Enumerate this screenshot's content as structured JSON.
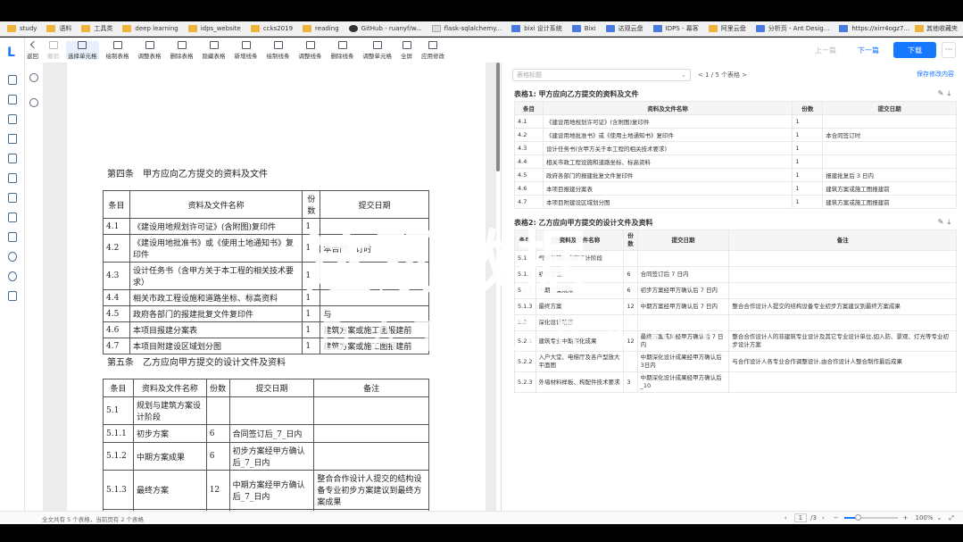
{
  "bookmarks": [
    {
      "label": "study",
      "icon": "folder-icon"
    },
    {
      "label": "语料",
      "icon": "folder-icon"
    },
    {
      "label": "工具类",
      "icon": "folder-icon"
    },
    {
      "label": "deep learning",
      "icon": "folder-icon"
    },
    {
      "label": "idps_website",
      "icon": "folder-icon"
    },
    {
      "label": "ccks2019",
      "icon": "folder-icon"
    },
    {
      "label": "reading",
      "icon": "folder-icon"
    },
    {
      "label": "GitHub - ruanyf/w...",
      "icon": "github-icon"
    },
    {
      "label": "flask-sqlalchemy...",
      "icon": "page-icon"
    },
    {
      "label": "bixi 设计系统",
      "icon": "site-icon"
    },
    {
      "label": "Bixi",
      "icon": "site-icon"
    },
    {
      "label": "达观云盘",
      "icon": "site-icon"
    },
    {
      "label": "IDPS - 幕客",
      "icon": "site-icon"
    },
    {
      "label": "阿里云盘",
      "icon": "folder-icon"
    },
    {
      "label": "分析页 - Ant Desig...",
      "icon": "site-icon"
    },
    {
      "label": "https://xirr4ogz7...",
      "icon": "site-icon"
    }
  ],
  "bookmarks_other": "其他收藏夹",
  "toolbar": [
    {
      "label": "返回",
      "icon": "back-icon",
      "state": "normal"
    },
    {
      "label": "撤销",
      "icon": "undo-icon",
      "state": "disabled"
    },
    {
      "label": "选择单元格",
      "icon": "select-cell-icon",
      "state": "selected"
    },
    {
      "label": "绘制表格",
      "icon": "draw-table-icon",
      "state": "normal"
    },
    {
      "label": "调整表格",
      "icon": "adjust-table-icon",
      "state": "normal"
    },
    {
      "label": "删除表格",
      "icon": "delete-table-icon",
      "state": "normal"
    },
    {
      "label": "隐藏表格",
      "icon": "hide-table-icon",
      "state": "normal"
    },
    {
      "label": "新增线条",
      "icon": "add-line-icon",
      "state": "normal"
    },
    {
      "label": "绘制线条",
      "icon": "draw-line-icon",
      "state": "normal"
    },
    {
      "label": "调整线条",
      "icon": "adjust-line-icon",
      "state": "normal"
    },
    {
      "label": "删除线条",
      "icon": "delete-line-icon",
      "state": "normal"
    },
    {
      "label": "调整单元格",
      "icon": "adjust-cell-icon",
      "state": "normal"
    },
    {
      "label": "全屏",
      "icon": "fullscreen-icon",
      "state": "normal"
    },
    {
      "label": "应用修改",
      "icon": "save-icon",
      "state": "normal"
    }
  ],
  "nav": {
    "prev": "上一篇",
    "next": "下一篇",
    "download": "下载",
    "more": "···"
  },
  "doc": {
    "article4_title": "第四条　甲方应向乙方提交的资料及文件",
    "t1_headers": [
      "条目",
      "资料及文件名称",
      "份数",
      "提交日期"
    ],
    "t1_rows": [
      [
        "4.1",
        "《建设用地规划许可证》(含附图)复印件",
        "1",
        ""
      ],
      [
        "4.2",
        "《建设用地批准书》或《使用土地通知书》复印件",
        "1",
        "本合同　订时"
      ],
      [
        "4.3",
        "设计任务书（含甲方关于本工程的相关技术要求）",
        "1",
        ""
      ],
      [
        "4.4",
        "相关市政工程设施和道路坐标、标高资料",
        "1",
        ""
      ],
      [
        "4.5",
        "政府各部门的报建批复文件复印件",
        "1",
        "与"
      ],
      [
        "4.6",
        "本项目报建分案表",
        "1",
        "建筑方案或施工图报建前"
      ],
      [
        "4.7",
        "本项目附建设区域划分图",
        "1",
        "建筑方案或施工图报建前"
      ]
    ],
    "article5_title": "第五条　乙方应向甲方提交的设计文件及资料",
    "t2_headers": [
      "条目",
      "资料及文件名称",
      "份数",
      "提交日期",
      "备注"
    ],
    "t2_rows": [
      [
        "5.1",
        "规划与建筑方案设计阶段",
        "",
        "",
        ""
      ],
      [
        "5.1.1",
        "初步方案",
        "6",
        "合同签订后_7_日内",
        ""
      ],
      [
        "5.1.2",
        "中期方案成果",
        "6",
        "初步方案经甲方确认后_7_日内",
        ""
      ],
      [
        "5.1.3",
        "最终方案",
        "12",
        "中期方案经甲方确认后_7_日内",
        "整合合作设计人提交的结构设备专业初步方案建议到最终方案成果"
      ],
      [
        "5.2",
        "深化设计阶段",
        "",
        "",
        ""
      ],
      [
        "5.2.1",
        "建筑专业中期深",
        "",
        "最终方案成果经甲",
        "整合合作设计人的非建筑专业设计及其它专业设计单位、如入防、景观、"
      ]
    ]
  },
  "right": {
    "table_select_placeholder": "表格标题",
    "pager": "< 1 / 5 个表格 >",
    "save_label": "保存修改内容",
    "table1_title": "表格1: 甲方应向乙方提交的资料及文件",
    "table1_headers": [
      "条目",
      "资料及文件名称",
      "份数",
      "提交日期"
    ],
    "table1_rows": [
      [
        "4.1",
        "《建设用地规划许可证》(含附图)复印件",
        "1",
        ""
      ],
      [
        "4.2",
        "《建设用地批准书》或《使用土地通知书》复印件",
        "1",
        "本合同签订时"
      ],
      [
        "4.3",
        "设计任务书(含甲方关于本工程的相关技术要求)",
        "1",
        ""
      ],
      [
        "4.4",
        "相关市政工程设施和道路坐标、标高资料",
        "1",
        ""
      ],
      [
        "4.5",
        "政府各部门的报建批复文件复印件",
        "1",
        "报建批复后 3 日内"
      ],
      [
        "4.6",
        "本项目报建分案表",
        "1",
        "建筑方案或施工图报建前"
      ],
      [
        "4.7",
        "本项目附建设区域划分图",
        "1",
        "建筑方案或施工图报建前"
      ]
    ],
    "table2_title": "表格2: 乙方应向甲方提交的设计文件及资料",
    "table2_headers": [
      "条目",
      "资料及文件名称",
      "份数",
      "提交日期",
      "备注"
    ],
    "table2_rows": [
      [
        "5.1",
        "规划与建筑方案设计阶段",
        "",
        "",
        ""
      ],
      [
        "5.1.1",
        "初步方案",
        "6",
        "合同签订后 7 日内",
        ""
      ],
      [
        "5.1.2",
        "中期方案成果",
        "6",
        "初步方案经甲方确认后 7 日内",
        ""
      ],
      [
        "5.1.3",
        "最终方案",
        "12",
        "中期方案经甲方确认后 7 日内",
        "整合合作设计人提交的结构设备专业初步方案建议到最终方案成果"
      ],
      [
        "5.2",
        "深化设计阶段",
        "",
        "",
        ""
      ],
      [
        "5.2.1",
        "建筑专业中期深化成果",
        "12",
        "最终方案成果经甲方确认后 7 日内",
        "整合合作设计人的非建筑专业设计及其它专业设计单位,如入防、景观、灯光等专业初步设计方案"
      ],
      [
        "5.2.2",
        "入户大堂、电梯厅及各户型放大平面图",
        "",
        "中期深化设计成果经甲方确认后 3日内",
        "与合作设计人各专业合作调整设计,由合作设计人整合制作最后成果"
      ],
      [
        "5.2.3",
        "外墙材料样板、构配件技术要求",
        "3",
        "中期深化设计成果经甲方确认后_10",
        ""
      ]
    ]
  },
  "watermark": {
    "line1": "达观数据",
    "line2": "DATAGRAND"
  },
  "status": {
    "left": "全文共有 5 个表格，当前页有 2 个表格",
    "page_current": "1",
    "page_total": "/3",
    "zoom": "100%",
    "zoom_fraction": 0.25
  }
}
